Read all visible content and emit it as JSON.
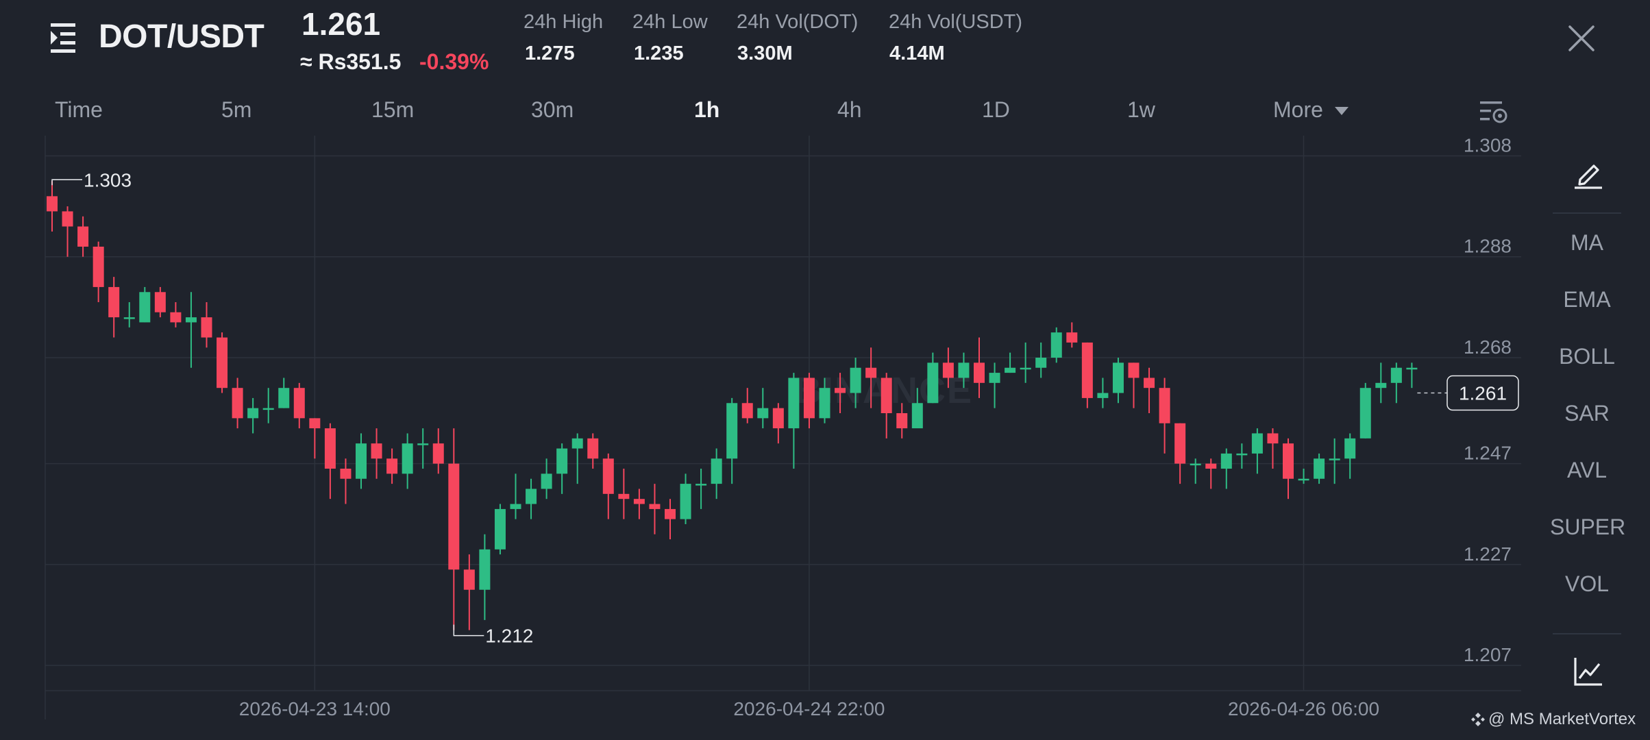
{
  "header": {
    "pair": "DOT/USDT",
    "price": "1.261",
    "fiat_price": "≈ Rs351.5",
    "change": "-0.39%",
    "stats": [
      {
        "label": "24h High",
        "value": "1.275"
      },
      {
        "label": "24h Low",
        "value": "1.235"
      },
      {
        "label": "24h Vol(DOT)",
        "value": "3.30M"
      },
      {
        "label": "24h Vol(USDT)",
        "value": "4.14M"
      }
    ],
    "icons": [
      "menu-icon",
      "close-icon"
    ]
  },
  "intervals": {
    "items": [
      "Time",
      "5m",
      "15m",
      "30m",
      "1h",
      "4h",
      "1D",
      "1w"
    ],
    "active": "1h",
    "more": "More"
  },
  "sidebar": {
    "indicators": [
      "MA",
      "EMA",
      "BOLL",
      "SAR",
      "AVL",
      "SUPER",
      "VOL"
    ],
    "icons": [
      "pencil-icon",
      "line-chart-icon"
    ]
  },
  "watermark": {
    "exchange": "BINANCE",
    "credit": "@ MS MarketVortex"
  },
  "colors": {
    "background": "#1f232c",
    "up": "#2ebd85",
    "down": "#f6465d",
    "text": "#eaecef",
    "muted": "#8f96a3"
  },
  "chart_data": {
    "type": "candlestick",
    "interval": "1h",
    "y_ticks": [
      "1.308",
      "1.288",
      "1.268",
      "1.247",
      "1.227",
      "1.207"
    ],
    "ylim": [
      1.202,
      1.312
    ],
    "x_ticks": [
      {
        "label": "2026-04-23 14:00",
        "index": 17
      },
      {
        "label": "2026-04-24 22:00",
        "index": 49
      },
      {
        "label": "2026-04-26 06:00",
        "index": 81
      }
    ],
    "last_price": "1.261",
    "high_label": "1.303",
    "low_label": "1.212",
    "candles": [
      [
        1.3,
        1.297,
        1.303,
        1.293
      ],
      [
        1.297,
        1.294,
        1.298,
        1.288
      ],
      [
        1.294,
        1.29,
        1.296,
        1.288
      ],
      [
        1.29,
        1.282,
        1.291,
        1.279
      ],
      [
        1.282,
        1.276,
        1.284,
        1.272
      ],
      [
        1.276,
        1.276,
        1.279,
        1.274
      ],
      [
        1.275,
        1.281,
        1.282,
        1.275
      ],
      [
        1.281,
        1.277,
        1.282,
        1.276
      ],
      [
        1.277,
        1.275,
        1.279,
        1.274
      ],
      [
        1.275,
        1.276,
        1.281,
        1.266
      ],
      [
        1.276,
        1.272,
        1.279,
        1.27
      ],
      [
        1.272,
        1.262,
        1.273,
        1.261
      ],
      [
        1.262,
        1.256,
        1.264,
        1.254
      ],
      [
        1.256,
        1.258,
        1.26,
        1.253
      ],
      [
        1.258,
        1.258,
        1.262,
        1.255
      ],
      [
        1.258,
        1.262,
        1.264,
        1.258
      ],
      [
        1.262,
        1.256,
        1.263,
        1.254
      ],
      [
        1.256,
        1.254,
        1.256,
        1.248
      ],
      [
        1.254,
        1.246,
        1.255,
        1.24
      ],
      [
        1.246,
        1.244,
        1.248,
        1.239
      ],
      [
        1.244,
        1.251,
        1.253,
        1.242
      ],
      [
        1.251,
        1.248,
        1.254,
        1.244
      ],
      [
        1.248,
        1.245,
        1.25,
        1.243
      ],
      [
        1.245,
        1.251,
        1.253,
        1.242
      ],
      [
        1.251,
        1.251,
        1.254,
        1.246
      ],
      [
        1.251,
        1.247,
        1.254,
        1.245
      ],
      [
        1.247,
        1.226,
        1.254,
        1.214
      ],
      [
        1.226,
        1.222,
        1.229,
        1.214
      ],
      [
        1.222,
        1.23,
        1.233,
        1.216
      ],
      [
        1.23,
        1.238,
        1.239,
        1.229
      ],
      [
        1.238,
        1.239,
        1.245,
        1.236
      ],
      [
        1.239,
        1.242,
        1.244,
        1.236
      ],
      [
        1.242,
        1.245,
        1.248,
        1.24
      ],
      [
        1.245,
        1.25,
        1.251,
        1.241
      ],
      [
        1.25,
        1.252,
        1.253,
        1.243
      ],
      [
        1.252,
        1.248,
        1.253,
        1.246
      ],
      [
        1.248,
        1.241,
        1.249,
        1.236
      ],
      [
        1.241,
        1.24,
        1.246,
        1.236
      ],
      [
        1.24,
        1.239,
        1.242,
        1.236
      ],
      [
        1.239,
        1.238,
        1.243,
        1.233
      ],
      [
        1.238,
        1.236,
        1.24,
        1.232
      ],
      [
        1.236,
        1.243,
        1.245,
        1.235
      ],
      [
        1.243,
        1.243,
        1.246,
        1.238
      ],
      [
        1.243,
        1.248,
        1.25,
        1.24
      ],
      [
        1.248,
        1.259,
        1.26,
        1.243
      ],
      [
        1.259,
        1.256,
        1.262,
        1.255
      ],
      [
        1.256,
        1.258,
        1.262,
        1.254
      ],
      [
        1.258,
        1.254,
        1.259,
        1.251
      ],
      [
        1.254,
        1.264,
        1.265,
        1.246
      ],
      [
        1.264,
        1.256,
        1.265,
        1.254
      ],
      [
        1.256,
        1.262,
        1.264,
        1.255
      ],
      [
        1.262,
        1.261,
        1.265,
        1.257
      ],
      [
        1.261,
        1.266,
        1.268,
        1.258
      ],
      [
        1.266,
        1.264,
        1.27,
        1.258
      ],
      [
        1.264,
        1.257,
        1.265,
        1.252
      ],
      [
        1.257,
        1.254,
        1.259,
        1.252
      ],
      [
        1.254,
        1.259,
        1.262,
        1.255
      ],
      [
        1.259,
        1.267,
        1.269,
        1.259
      ],
      [
        1.267,
        1.264,
        1.27,
        1.262
      ],
      [
        1.264,
        1.267,
        1.269,
        1.262
      ],
      [
        1.267,
        1.263,
        1.272,
        1.26
      ],
      [
        1.263,
        1.265,
        1.267,
        1.258
      ],
      [
        1.265,
        1.266,
        1.269,
        1.265
      ],
      [
        1.266,
        1.266,
        1.271,
        1.263
      ],
      [
        1.266,
        1.268,
        1.271,
        1.264
      ],
      [
        1.268,
        1.273,
        1.274,
        1.267
      ],
      [
        1.273,
        1.271,
        1.275,
        1.27
      ],
      [
        1.271,
        1.26,
        1.271,
        1.258
      ],
      [
        1.26,
        1.261,
        1.264,
        1.258
      ],
      [
        1.261,
        1.267,
        1.268,
        1.259
      ],
      [
        1.267,
        1.264,
        1.267,
        1.258
      ],
      [
        1.264,
        1.262,
        1.266,
        1.257
      ],
      [
        1.262,
        1.255,
        1.264,
        1.249
      ],
      [
        1.255,
        1.247,
        1.255,
        1.243
      ],
      [
        1.247,
        1.247,
        1.248,
        1.243
      ],
      [
        1.247,
        1.246,
        1.248,
        1.242
      ],
      [
        1.246,
        1.249,
        1.25,
        1.242
      ],
      [
        1.249,
        1.249,
        1.251,
        1.246
      ],
      [
        1.249,
        1.253,
        1.254,
        1.245
      ],
      [
        1.253,
        1.251,
        1.254,
        1.246
      ],
      [
        1.251,
        1.244,
        1.252,
        1.24
      ],
      [
        1.244,
        1.244,
        1.246,
        1.243
      ],
      [
        1.244,
        1.248,
        1.249,
        1.243
      ],
      [
        1.248,
        1.248,
        1.252,
        1.243
      ],
      [
        1.248,
        1.252,
        1.253,
        1.244
      ],
      [
        1.252,
        1.262,
        1.263,
        1.252
      ],
      [
        1.262,
        1.263,
        1.267,
        1.259
      ],
      [
        1.263,
        1.266,
        1.267,
        1.259
      ],
      [
        1.266,
        1.266,
        1.267,
        1.262
      ]
    ]
  }
}
